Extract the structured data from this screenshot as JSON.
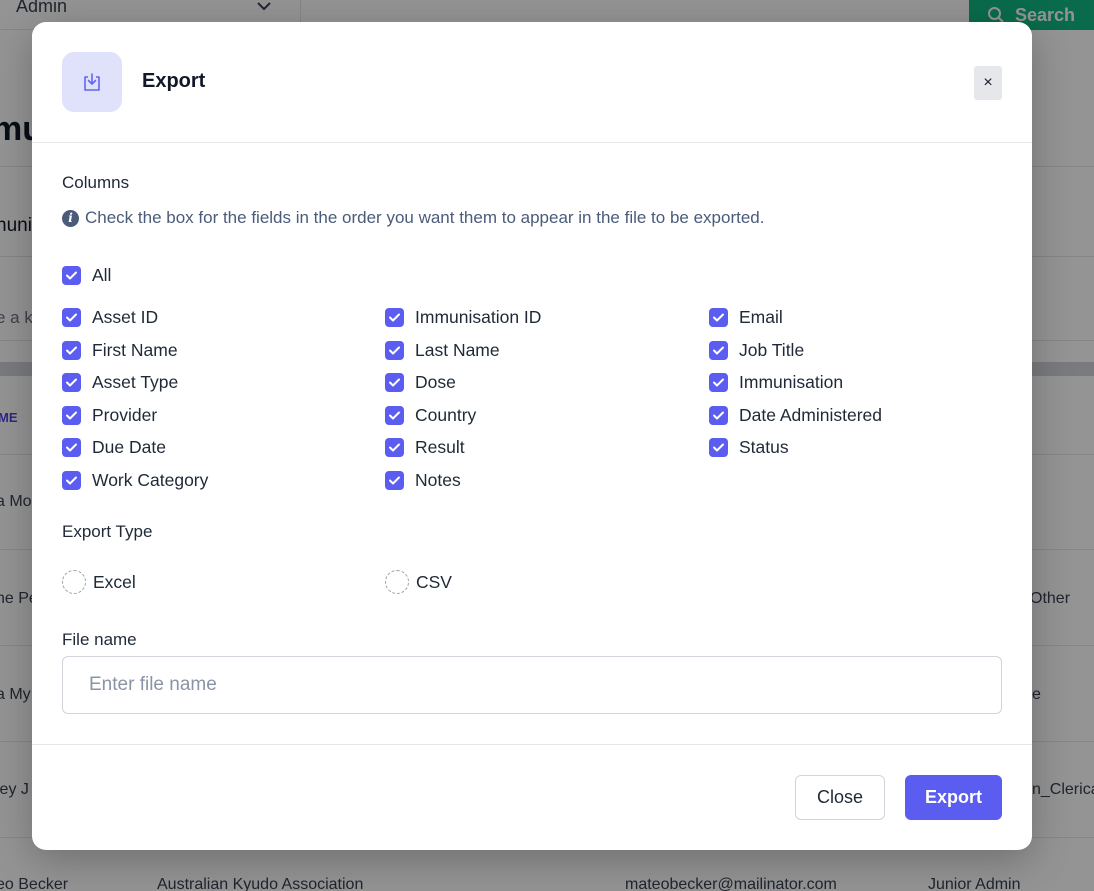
{
  "background": {
    "role_select": "Admin",
    "search_button": "Search",
    "page_title_fragment": "mu",
    "tab_fragment": "nuni",
    "search_fragment": "e a k",
    "column_header_fragment": "ME",
    "rows": [
      {
        "name": "a Mo",
        "extra": ""
      },
      {
        "name": "ne Pe",
        "extra": "Other"
      },
      {
        "name": "a My",
        "extra": "e"
      },
      {
        "name": "ley J",
        "extra": "n_Clerica"
      }
    ],
    "last_row": {
      "name": "eo Becker",
      "organisation": "Australian Kyudo Association",
      "email": "mateobecker@mailinator.com",
      "role": "Junior Admin"
    }
  },
  "modal": {
    "title": "Export",
    "close_symbol": "×",
    "columns_label": "Columns",
    "hint": "Check the box for the fields in the order you want them to appear in the file to be exported.",
    "all_label": "All",
    "columns": [
      [
        "Asset ID",
        "First Name",
        "Asset Type",
        "Provider",
        "Due Date",
        "Work Category"
      ],
      [
        "Immunisation ID",
        "Last Name",
        "Dose",
        "Country",
        "Result",
        "Notes"
      ],
      [
        "Email",
        "Job Title",
        "Immunisation",
        "Date Administered",
        "Status"
      ]
    ],
    "export_type_label": "Export Type",
    "export_types": [
      "Excel",
      "CSV"
    ],
    "file_name_label": "File name",
    "file_name_placeholder": "Enter file name",
    "file_name_value": "",
    "close_button": "Close",
    "export_button": "Export",
    "accent_color": "#5b5cf0"
  }
}
